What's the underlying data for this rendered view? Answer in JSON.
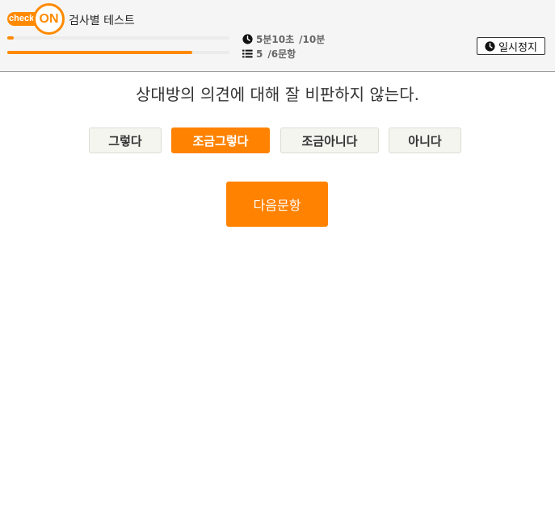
{
  "header": {
    "logo_left": "check",
    "logo_right": "ON",
    "title": "검사별 테스트",
    "timer": {
      "elapsed": "5분10초",
      "total": "/10분",
      "progress": 0.03
    },
    "question_count": {
      "current": "5",
      "total": "/6문항",
      "progress": 0.833
    },
    "pause_label": "일시정지"
  },
  "question": {
    "text": "상대방의 의견에 대해 잘 비판하지 않는다."
  },
  "choices": [
    {
      "label": "그렇다",
      "selected": false
    },
    {
      "label": "조금그렇다",
      "selected": true
    },
    {
      "label": "조금아니다",
      "selected": false
    },
    {
      "label": "아니다",
      "selected": false
    }
  ],
  "next_label": "다음문항",
  "colors": {
    "accent": "#ff8200",
    "header_bg": "#f5f5f5",
    "choice_bg": "#f5f5f0"
  },
  "icons": {
    "timer": "clock-icon",
    "count": "list-icon",
    "pause": "clock-icon"
  }
}
